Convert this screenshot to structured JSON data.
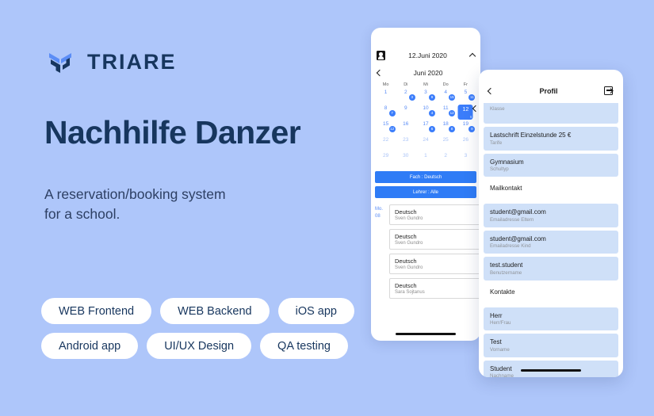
{
  "background_color": "#aec6fa",
  "accent_color": "#3b7dfb",
  "brand": {
    "logo_icon": "triare-logo-icon",
    "name": "TRIARE",
    "color": "#17365e"
  },
  "hero": {
    "title": "Nachhilfe Danzer",
    "subtitle_line1": "A reservation/booking system",
    "subtitle_line2": "for a school."
  },
  "tags": {
    "row1": [
      "WEB Frontend",
      "WEB Backend",
      "iOS app"
    ],
    "row2": [
      "Android app",
      "UI/UX Design",
      "QA testing"
    ]
  },
  "calendar_phone": {
    "person_icon": "person-icon",
    "date_label": "12.Juni 2020",
    "collapse_icon": "chevron-up-icon",
    "prev_icon": "chevron-left-icon",
    "next_icon": "chevron-left-icon",
    "month_label": "Juni 2020",
    "day_headers": [
      "Mo",
      "Di",
      "Mi",
      "Do",
      "Fr"
    ],
    "weeks": [
      [
        {
          "day": "1",
          "badge": "",
          "dim": false,
          "selected": false
        },
        {
          "day": "2",
          "badge": "3",
          "dim": false,
          "selected": false
        },
        {
          "day": "3",
          "badge": "9",
          "dim": false,
          "selected": false
        },
        {
          "day": "4",
          "badge": "15",
          "dim": false,
          "selected": false
        },
        {
          "day": "5",
          "badge": "11",
          "dim": false,
          "selected": false
        }
      ],
      [
        {
          "day": "8",
          "badge": "7",
          "dim": false,
          "selected": false
        },
        {
          "day": "9",
          "badge": "",
          "dim": false,
          "selected": false
        },
        {
          "day": "10",
          "badge": "4",
          "dim": false,
          "selected": false
        },
        {
          "day": "11",
          "badge": "12",
          "dim": false,
          "selected": false
        },
        {
          "day": "12",
          "badge": "6",
          "dim": false,
          "selected": true
        }
      ],
      [
        {
          "day": "15",
          "badge": "12",
          "dim": false,
          "selected": false
        },
        {
          "day": "16",
          "badge": "",
          "dim": false,
          "selected": false
        },
        {
          "day": "17",
          "badge": "6",
          "dim": false,
          "selected": false
        },
        {
          "day": "18",
          "badge": "8",
          "dim": false,
          "selected": false
        },
        {
          "day": "19",
          "badge": "9",
          "dim": false,
          "selected": false
        }
      ],
      [
        {
          "day": "22",
          "badge": "",
          "dim": true,
          "selected": false
        },
        {
          "day": "23",
          "badge": "",
          "dim": true,
          "selected": false
        },
        {
          "day": "24",
          "badge": "",
          "dim": true,
          "selected": false
        },
        {
          "day": "25",
          "badge": "",
          "dim": true,
          "selected": false
        },
        {
          "day": "26",
          "badge": "",
          "dim": true,
          "selected": false
        }
      ],
      [
        {
          "day": "29",
          "badge": "",
          "dim": true,
          "selected": false
        },
        {
          "day": "30",
          "badge": "",
          "dim": true,
          "selected": false
        },
        {
          "day": "1",
          "badge": "",
          "dim": true,
          "selected": false
        },
        {
          "day": "2",
          "badge": "",
          "dim": true,
          "selected": false
        },
        {
          "day": "3",
          "badge": "",
          "dim": true,
          "selected": false
        }
      ]
    ],
    "filter_subject": "Fach : Deutsch",
    "filter_teacher": "Lehrer : Alle",
    "day_label_line1": "Mo.",
    "day_label_line2": "08",
    "lessons": [
      {
        "title": "Deutsch",
        "teacher": "Sven Gundro"
      },
      {
        "title": "Deutsch",
        "teacher": "Sven Gundro"
      },
      {
        "title": "Deutsch",
        "teacher": "Sven Gundro"
      },
      {
        "title": "Deutsch",
        "teacher": "Sara Sojtanus"
      }
    ]
  },
  "profile_phone": {
    "back_icon": "chevron-left-icon",
    "title": "Profil",
    "exit_icon": "logout-icon",
    "rows": [
      {
        "value": "",
        "key": "Klasse",
        "style": "filled",
        "partial": true
      },
      {
        "value": "Lastschrift Einzelstunde 25 €",
        "key": "Tarife",
        "style": "filled",
        "partial": false
      },
      {
        "value": "Gymnasium",
        "key": "Schultyp",
        "style": "filled",
        "partial": false
      },
      {
        "value": "Mailkontakt",
        "key": "",
        "style": "plain",
        "partial": false
      },
      {
        "value": "student@gmail.com",
        "key": "Emailadresse Eltern",
        "style": "filled",
        "partial": false
      },
      {
        "value": "student@gmail.com",
        "key": "Emailadresse Kind",
        "style": "filled",
        "partial": false
      },
      {
        "value": "test.student",
        "key": "Benutzername",
        "style": "filled",
        "partial": false
      },
      {
        "value": "Kontakte",
        "key": "",
        "style": "plain",
        "partial": false
      },
      {
        "value": "Herr",
        "key": "Herr/Frau",
        "style": "filled",
        "partial": false
      },
      {
        "value": "Test",
        "key": "Vorname",
        "style": "filled",
        "partial": false
      },
      {
        "value": "Student",
        "key": "Nachname",
        "style": "filled",
        "partial": false
      }
    ]
  }
}
